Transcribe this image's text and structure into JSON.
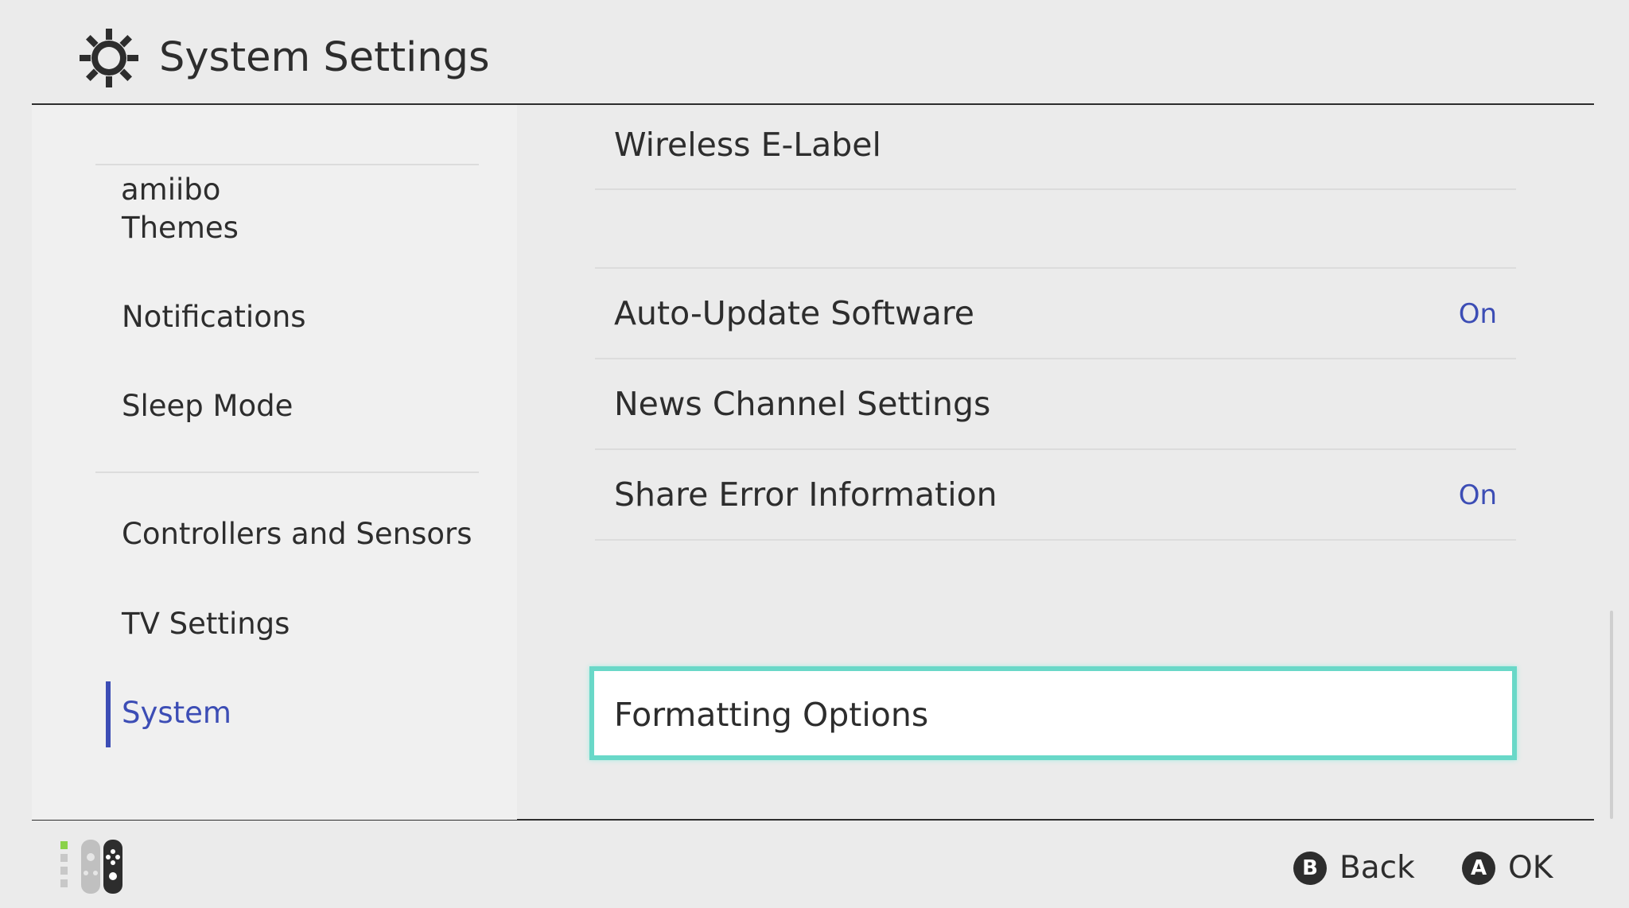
{
  "header": {
    "title": "System Settings",
    "icon": "gear-icon"
  },
  "sidebar": {
    "cut_item": "amiibo",
    "items": [
      {
        "label": "Themes"
      },
      {
        "label": "Notifications"
      },
      {
        "label": "Sleep Mode"
      },
      {
        "label": "Controllers and Sensors"
      },
      {
        "label": "TV Settings"
      },
      {
        "label": "System",
        "active": true
      }
    ]
  },
  "content": {
    "rows": [
      {
        "label": "Wireless E-Label",
        "value": ""
      },
      {
        "label": "Auto-Update Software",
        "value": "On"
      },
      {
        "label": "News Channel Settings",
        "value": ""
      },
      {
        "label": "Share Error Information",
        "value": "On"
      },
      {
        "label": "Formatting Options",
        "value": "",
        "focused": true
      }
    ]
  },
  "footer": {
    "controller_icon": "joycon-icon",
    "back": {
      "button": "B",
      "label": "Back"
    },
    "ok": {
      "button": "A",
      "label": "OK"
    }
  },
  "colors": {
    "background": "#ebebeb",
    "sidebar": "#f0f0f0",
    "accent": "#3c4db5",
    "focus": "#69d8c8",
    "text": "#2d2d2d"
  }
}
